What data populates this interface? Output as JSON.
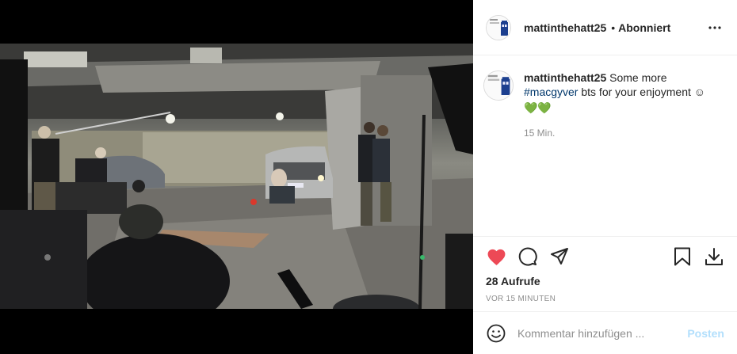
{
  "post": {
    "username": "mattinthehatt25",
    "separator": "•",
    "follow_status": "Abonniert",
    "avatar_icon": "tardis-avatar-icon",
    "caption_text_before": "Some more",
    "hashtag": "#macgyver",
    "caption_text_after": "bts for your enjoyment ☺",
    "caption_emojis": "💚💚",
    "caption_time": "15 Min.",
    "views": "28 Aufrufe",
    "posted_ago": "VOR 15 MINUTEN",
    "liked": true,
    "like_color": "#ed4956"
  },
  "comment_box": {
    "placeholder": "Kommentar hinzufügen ...",
    "post_label": "Posten",
    "post_color": "#b2dffc"
  },
  "video": {
    "media_icon": "video-still",
    "sound_icon": "speaker-icon"
  }
}
